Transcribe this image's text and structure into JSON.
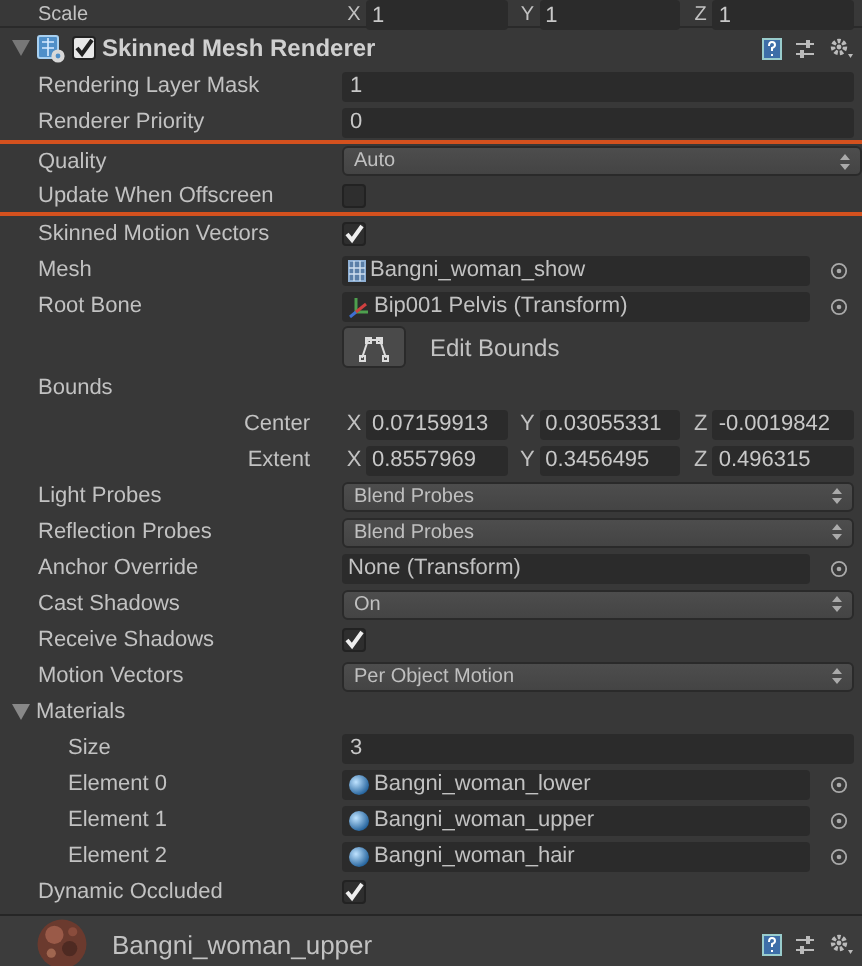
{
  "scale_row": {
    "label": "Scale",
    "axes": [
      {
        "axis": "X",
        "value": "1"
      },
      {
        "axis": "Y",
        "value": "1"
      },
      {
        "axis": "Z",
        "value": "1"
      }
    ]
  },
  "component": {
    "title": "Skinned Mesh Renderer",
    "enabled": true,
    "expanded": true
  },
  "properties": [
    {
      "kind": "field",
      "label": "Rendering Layer Mask",
      "value": "1"
    },
    {
      "kind": "field",
      "label": "Renderer Priority",
      "value": "0"
    },
    {
      "kind": "dropdown",
      "label": "Quality",
      "value": "Auto",
      "highlighted": true
    },
    {
      "kind": "checkbox",
      "label": "Update When Offscreen",
      "checked": false,
      "highlighted": true
    },
    {
      "kind": "checkbox",
      "label": "Skinned Motion Vectors",
      "checked": true
    },
    {
      "kind": "mesh_ref",
      "label": "Mesh",
      "value": "Bangni_woman_show"
    },
    {
      "kind": "transform_ref",
      "label": "Root Bone",
      "value": "Bip001 Pelvis (Transform)"
    },
    {
      "kind": "button",
      "label": "Edit Bounds"
    },
    {
      "kind": "heading",
      "label": "Bounds"
    },
    {
      "kind": "vector",
      "label": "Center",
      "axes": [
        {
          "axis": "X",
          "value": "0.07159913"
        },
        {
          "axis": "Y",
          "value": "0.03055331"
        },
        {
          "axis": "Z",
          "value": "-0.0019842"
        }
      ]
    },
    {
      "kind": "vector",
      "label": "Extent",
      "axes": [
        {
          "axis": "X",
          "value": "0.8557969"
        },
        {
          "axis": "Y",
          "value": "0.3456495"
        },
        {
          "axis": "Z",
          "value": "0.496315"
        }
      ]
    },
    {
      "kind": "dropdown",
      "label": "Light Probes",
      "value": "Blend Probes"
    },
    {
      "kind": "dropdown",
      "label": "Reflection Probes",
      "value": "Blend Probes"
    },
    {
      "kind": "object",
      "label": "Anchor Override",
      "value": "None (Transform)"
    },
    {
      "kind": "dropdown",
      "label": "Cast Shadows",
      "value": "On"
    },
    {
      "kind": "checkbox",
      "label": "Receive Shadows",
      "checked": true
    },
    {
      "kind": "dropdown",
      "label": "Motion Vectors",
      "value": "Per Object Motion"
    },
    {
      "kind": "foldout",
      "label": "Materials",
      "expanded": true,
      "children": [
        {
          "kind": "field",
          "label": "Size",
          "value": "3"
        },
        {
          "kind": "material_ref",
          "label": "Element 0",
          "value": "Bangni_woman_lower"
        },
        {
          "kind": "material_ref",
          "label": "Element 1",
          "value": "Bangni_woman_upper"
        },
        {
          "kind": "material_ref",
          "label": "Element 2",
          "value": "Bangni_woman_hair"
        }
      ]
    },
    {
      "kind": "checkbox",
      "label": "Dynamic Occluded",
      "checked": true
    }
  ],
  "preview": {
    "title": "Bangni_woman_upper"
  }
}
